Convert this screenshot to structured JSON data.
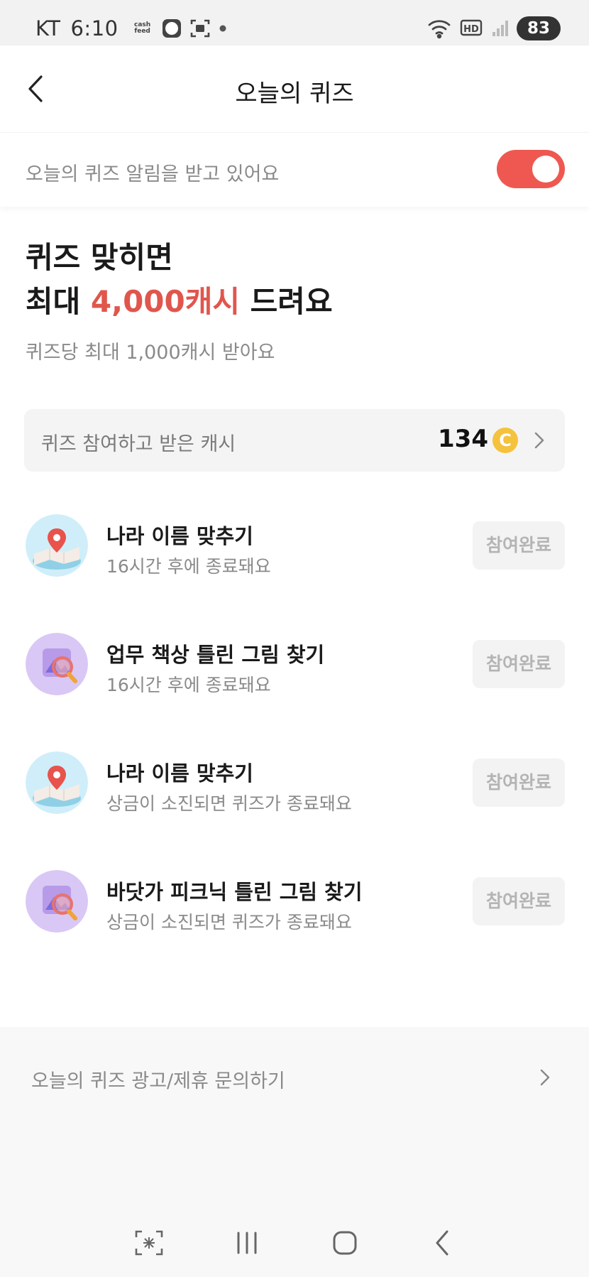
{
  "status_bar": {
    "carrier": "KT",
    "time": "6:10",
    "app_icon_text": "cash feed",
    "battery": "83",
    "network_badge": "HD"
  },
  "header": {
    "title": "오늘의 퀴즈"
  },
  "notification": {
    "label": "오늘의 퀴즈 알림을 받고 있어요",
    "enabled": true,
    "accent_color": "#ee5851"
  },
  "hero": {
    "line1": "퀴즈 맞히면",
    "line2_prefix": "최대 ",
    "line2_highlight": "4,000캐시",
    "line2_suffix": " 드려요",
    "subtitle": "퀴즈당 최대 1,000캐시 받아요",
    "highlight_color": "#e0564d"
  },
  "cash_summary": {
    "label": "퀴즈 참여하고 받은 캐시",
    "value": "134",
    "coin_symbol": "C"
  },
  "quizzes": [
    {
      "title": "나라 이름 맞추기",
      "subtitle": "16시간 후에 종료돼요",
      "button": "참여완료",
      "icon": "map-pin-icon"
    },
    {
      "title": "업무 책상 틀린 그림 찾기",
      "subtitle": "16시간 후에 종료돼요",
      "button": "참여완료",
      "icon": "magnifier-picture-icon"
    },
    {
      "title": "나라 이름 맞추기",
      "subtitle": "상금이 소진되면 퀴즈가 종료돼요",
      "button": "참여완료",
      "icon": "map-pin-icon"
    },
    {
      "title": "바닷가 피크닉 틀린 그림 찾기",
      "subtitle": "상금이 소진되면 퀴즈가 종료돼요",
      "button": "참여완료",
      "icon": "magnifier-picture-icon"
    }
  ],
  "footer": {
    "link_label": "오늘의 퀴즈 광고/제휴 문의하기"
  }
}
